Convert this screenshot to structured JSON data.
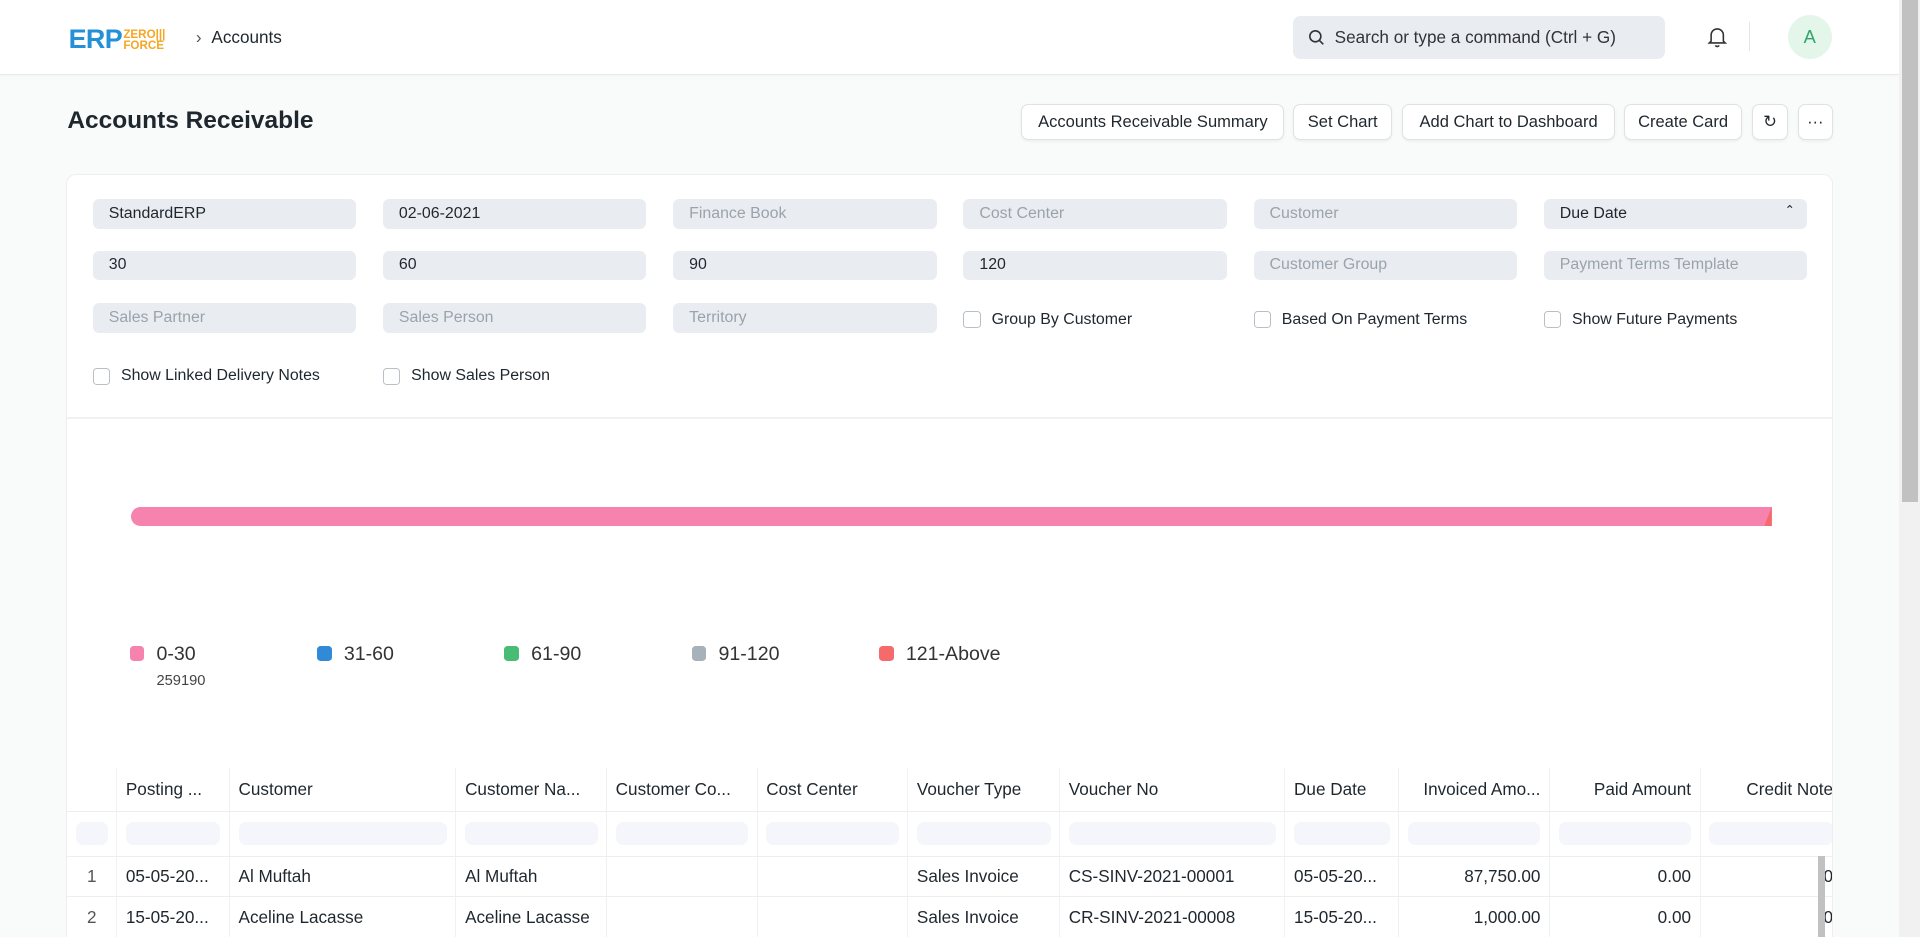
{
  "navbar": {
    "logo": "ERP ZERO FORCE",
    "logo_main": "ERP",
    "logo_sub1": "ZERO",
    "logo_sub2": "FORCE",
    "breadcrumb": "Accounts",
    "search_placeholder": "Search or type a command (Ctrl + G)",
    "avatar": "A"
  },
  "page": {
    "title": "Accounts Receivable",
    "buttons": [
      "Accounts Receivable Summary",
      "Set Chart",
      "Add Chart to Dashboard",
      "Create Card"
    ]
  },
  "filters": {
    "row1": [
      {
        "value": "StandardERP"
      },
      {
        "value": "02-06-2021"
      },
      {
        "placeholder": "Finance Book"
      },
      {
        "placeholder": "Cost Center"
      },
      {
        "placeholder": "Customer"
      },
      {
        "value": "Due Date"
      }
    ],
    "row2": [
      {
        "value": "30"
      },
      {
        "value": "60"
      },
      {
        "value": "90"
      },
      {
        "value": "120"
      },
      {
        "placeholder": "Customer Group"
      },
      {
        "placeholder": "Payment Terms Template"
      }
    ],
    "row3": [
      {
        "placeholder": "Sales Partner"
      },
      {
        "placeholder": "Sales Person"
      },
      {
        "placeholder": "Territory"
      }
    ],
    "checkboxes": [
      "Group By Customer",
      "Based On Payment Terms",
      "Show Future Payments",
      "Show Linked Delivery Notes",
      "Show Sales Person"
    ]
  },
  "chart_data": {
    "type": "bar",
    "orientation": "horizontal-stacked",
    "categories": [
      "0-30",
      "31-60",
      "61-90",
      "91-120",
      "121-Above"
    ],
    "values": [
      259190,
      0,
      0,
      0,
      null
    ],
    "legend_values": [
      "259190",
      "",
      "",
      "",
      ""
    ],
    "colors": [
      "#f683ae",
      "#318ad8",
      "#48bb74",
      "#a6b1b9",
      "#f56b6b"
    ],
    "legend": "bottom-left"
  },
  "table": {
    "columns": [
      "Posting ...",
      "Customer",
      "Customer Na...",
      "Customer Co...",
      "Cost Center",
      "Voucher Type",
      "Voucher No",
      "Due Date",
      "Invoiced Amo...",
      "Paid Amount",
      "Credit Note"
    ],
    "rows": [
      [
        "1",
        "05-05-20...",
        "Al Muftah",
        "Al Muftah",
        "",
        "",
        "Sales Invoice",
        "CS-SINV-2021-00001",
        "05-05-20...",
        "87,750.00",
        "0.00",
        "0"
      ],
      [
        "2",
        "15-05-20...",
        "Aceline Lacasse",
        "Aceline Lacasse",
        "",
        "",
        "Sales Invoice",
        "CR-SINV-2021-00008",
        "15-05-20...",
        "1,000.00",
        "0.00",
        "0"
      ]
    ]
  }
}
